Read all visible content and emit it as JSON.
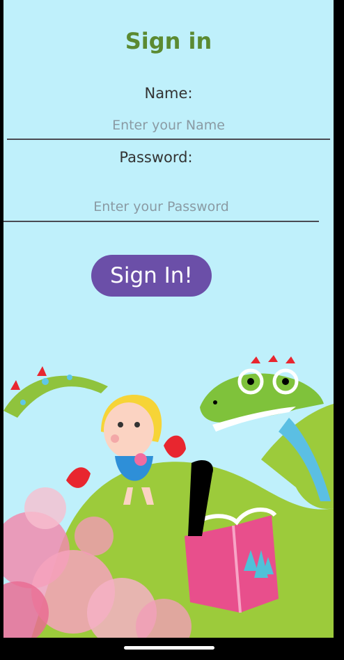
{
  "header": {
    "title": "Sign in"
  },
  "form": {
    "name_label": "Name:",
    "name_placeholder": "Enter your Name",
    "name_value": "",
    "password_label": "Password:",
    "password_placeholder": "Enter your Password",
    "password_value": "",
    "submit_label": "Sign In!"
  },
  "colors": {
    "background": "#bff0fb",
    "title": "#5b8a32",
    "button": "#6b4fa8",
    "button_text": "#ffffff"
  },
  "illustration": {
    "icon": "kids-reading-dinosaur-illustration"
  }
}
